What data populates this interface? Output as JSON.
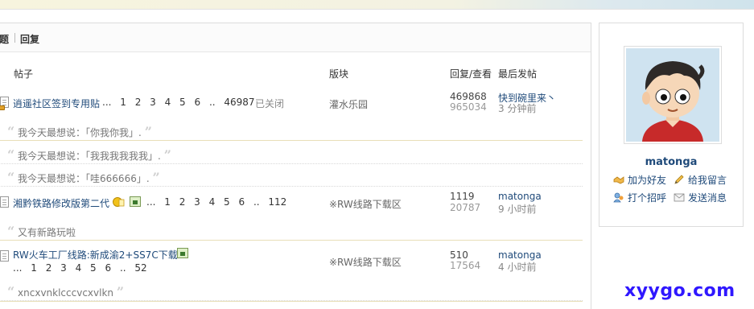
{
  "tabs": {
    "first": "题",
    "second": "回复"
  },
  "columns": {
    "thread": "帖子",
    "forum": "版块",
    "stats": "回复/查看",
    "last": "最后发帖"
  },
  "threads": [
    {
      "title": "逍遥社区签到专用贴",
      "pages": "... 1 2 3 4 5 6 .. 46987",
      "status": "已关闭",
      "forum": "灌水乐园",
      "replies": "469868",
      "views": "965034",
      "last_user": "快到碗里来丶",
      "last_time": "3 分钟前",
      "quotes": [
        "我今天最想说：「你我你我」.",
        "我今天最想说：「我我我我我我」.",
        "我今天最想说：「哇666666」."
      ]
    },
    {
      "title": "湘黔铁路修改版第二代",
      "pages": "... 1 2 3 4 5 6 .. 112",
      "forum": "※RW线路下载区",
      "replies": "1119",
      "views": "20787",
      "last_user": "matonga",
      "last_time": "9 小时前",
      "quotes": [
        "又有新路玩啦"
      ]
    },
    {
      "title": "RW火车工厂线路:新成渝2+SS7C下载",
      "pages": "... 1 2 3 4 5 6 .. 52",
      "forum": "※RW线路下载区",
      "replies": "510",
      "views": "17564",
      "last_user": "matonga",
      "last_time": "4 小时前",
      "quotes": [
        "xncxvnklcccvcxvlkn"
      ]
    }
  ],
  "profile": {
    "username": "matonga",
    "actions": [
      "加为好友",
      "给我留言",
      "打个招呼",
      "发送消息"
    ]
  },
  "watermark": "xyygo.com"
}
